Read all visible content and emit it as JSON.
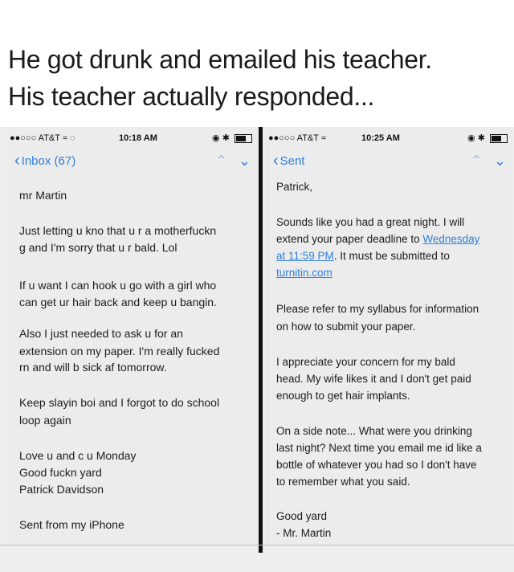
{
  "headline": {
    "line1": "He got drunk and emailed his teacher.",
    "line2": "His teacher actually responded..."
  },
  "left_phone": {
    "status": {
      "carrier": "●●○○○ AT&T ≈ ◌",
      "time": "10:18 AM"
    },
    "nav": {
      "back_label": "Inbox (67)"
    },
    "lines": [
      "mr Martin",
      "Just letting u kno that u r a motherfuckn",
      "g and I'm sorry that u r bald. Lol",
      "If u want I can hook u go with a girl who",
      "can get ur hair back and keep u bangin.",
      "Also I just needed to ask u for an",
      "extension on my paper. I'm really fucked",
      "rn and will b sick af tomorrow.",
      "Keep slayin boi and I forgot to do school",
      "loop again",
      "Love u and c u Monday",
      "Good fuckn yard",
      "Patrick Davidson",
      "Sent from my iPhone"
    ]
  },
  "right_phone": {
    "status": {
      "carrier": "●●○○○ AT&T ≈",
      "time": "10:25 AM"
    },
    "nav": {
      "back_label": "Sent"
    },
    "greeting": "Patrick,",
    "p1_line1": "Sounds like you had a great night. I will",
    "p1_line2_pre": "extend your paper deadline to ",
    "p1_line2_link": "Wednesday",
    "p1_line3_link": "at 11:59 PM",
    "p1_line3_post": ". It must be submitted to",
    "p1_line4_link": "turnitin.com",
    "p2_line1": "Please refer to my syllabus for information",
    "p2_line2": "on how to submit your paper.",
    "p3_line1": "I appreciate your concern for my bald",
    "p3_line2": "head. My wife likes it and I don't get paid",
    "p3_line3": "enough to get hair implants.",
    "p4_line1": "On a side note... What were you drinking",
    "p4_line2": "last night? Next time you email me id like a",
    "p4_line3": "bottle of whatever you had so I don't have",
    "p4_line4": "to remember what you said.",
    "signoff": "Good yard",
    "signature": "- Mr. Martin"
  },
  "icons": {
    "back": "chevron-left-icon",
    "prev": "chevron-up-icon",
    "next": "chevron-down-icon",
    "signal": "signal-dots-icon",
    "wifi": "wifi-icon",
    "battery": "battery-icon"
  },
  "colors": {
    "link": "#2f7fd8",
    "text": "#1c1c1c",
    "divider": "#111111"
  }
}
